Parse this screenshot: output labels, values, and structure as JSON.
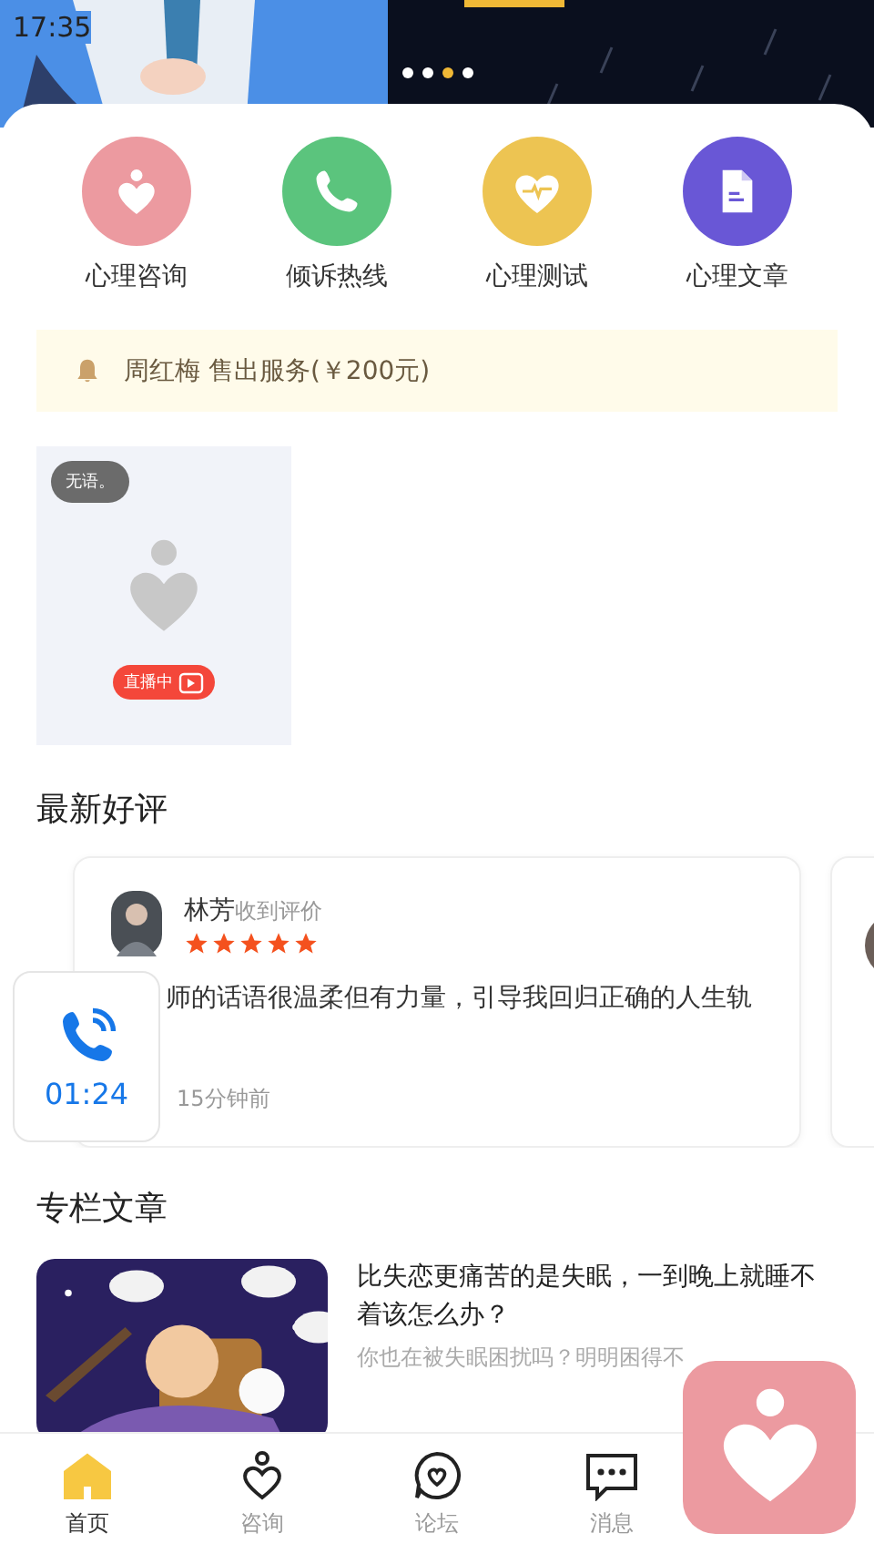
{
  "status_bar": {
    "time": "17:35"
  },
  "banner": {
    "dots": [
      {
        "selected": false
      },
      {
        "selected": false
      },
      {
        "selected": true
      },
      {
        "selected": false
      }
    ]
  },
  "quick_actions": [
    {
      "label": "心理咨询",
      "kind": "consult",
      "color": "#ec9aa0"
    },
    {
      "label": "倾诉热线",
      "kind": "phone",
      "color": "#5bc47d"
    },
    {
      "label": "心理测试",
      "kind": "test",
      "color": "#edc452"
    },
    {
      "label": "心理文章",
      "kind": "article",
      "color": "#6957d6"
    }
  ],
  "notice": {
    "text": "周红梅 售出服务(￥200元)"
  },
  "live_rooms": [
    {
      "name": "无语。",
      "badge": "直播中"
    }
  ],
  "reviews_section": {
    "title": "最新好评"
  },
  "reviews": [
    {
      "kind": "full",
      "name": "林芳",
      "action": "收到评价",
      "stars": 5,
      "text": "师的话语很温柔但有力量，引导我回归正确的人生轨",
      "time": "15分钟前"
    },
    {
      "kind": "partial"
    }
  ],
  "call_widget": {
    "duration": "01:24"
  },
  "articles_section": {
    "title": "专栏文章"
  },
  "articles": [
    {
      "title": "比失恋更痛苦的是失眠，一到晚上就睡不着该怎么办？",
      "summary": "你也在被失眠困扰吗？明明困得不"
    }
  ],
  "tab_bar": [
    {
      "label": "首页",
      "kind": "home",
      "selected": true
    },
    {
      "label": "咨询",
      "kind": "consult",
      "selected": false
    },
    {
      "label": "论坛",
      "kind": "forum",
      "selected": false
    },
    {
      "label": "消息",
      "kind": "message",
      "selected": false
    }
  ]
}
